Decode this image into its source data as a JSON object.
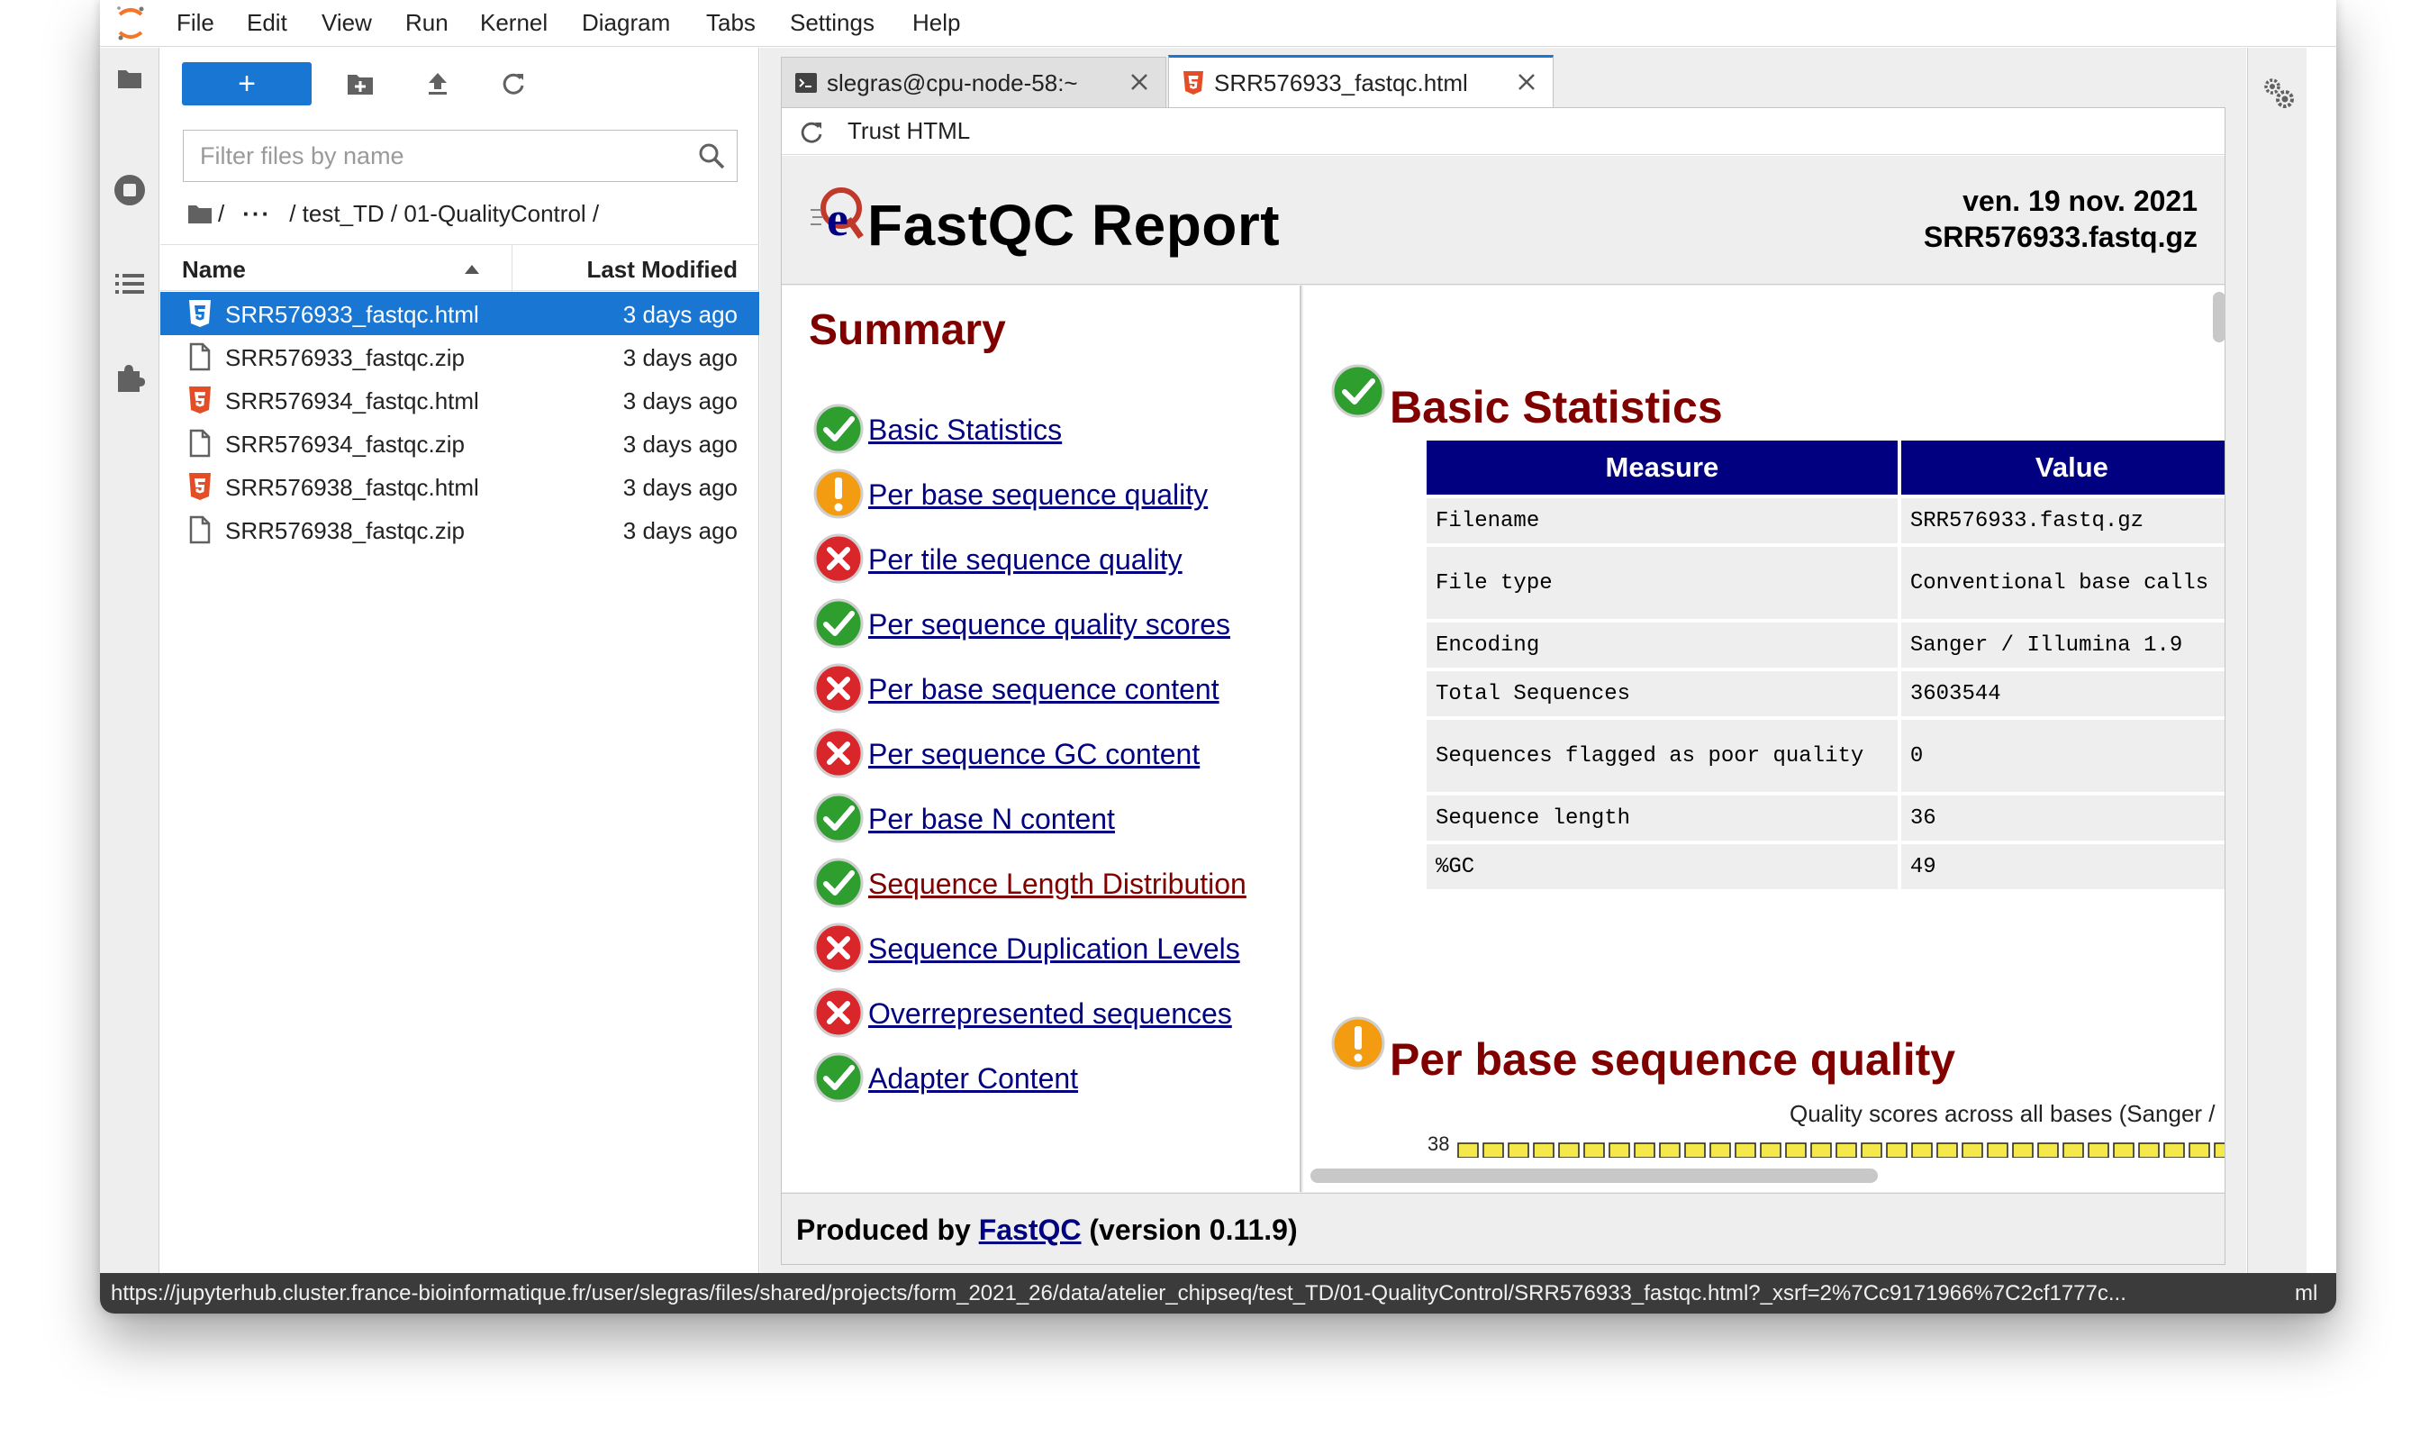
{
  "menu": {
    "items": [
      "File",
      "Edit",
      "View",
      "Run",
      "Kernel",
      "Diagram",
      "Tabs",
      "Settings",
      "Help"
    ]
  },
  "filebrowser": {
    "new_label": "+",
    "filter_placeholder": "Filter files by name",
    "breadcrumb": {
      "root": "/",
      "ellipsis": "···",
      "path": "/ test_TD / 01-QualityControl /"
    },
    "columns": {
      "name": "Name",
      "modified": "Last Modified"
    },
    "files": [
      {
        "name": "SRR576933_fastqc.html",
        "modified": "3 days ago",
        "type": "html",
        "selected": true
      },
      {
        "name": "SRR576933_fastqc.zip",
        "modified": "3 days ago",
        "type": "file",
        "selected": false
      },
      {
        "name": "SRR576934_fastqc.html",
        "modified": "3 days ago",
        "type": "html",
        "selected": false
      },
      {
        "name": "SRR576934_fastqc.zip",
        "modified": "3 days ago",
        "type": "file",
        "selected": false
      },
      {
        "name": "SRR576938_fastqc.html",
        "modified": "3 days ago",
        "type": "html",
        "selected": false
      },
      {
        "name": "SRR576938_fastqc.zip",
        "modified": "3 days ago",
        "type": "file",
        "selected": false
      }
    ]
  },
  "tabs": [
    {
      "label": "slegras@cpu-node-58:~",
      "icon": "terminal-icon",
      "active": false
    },
    {
      "label": "SRR576933_fastqc.html",
      "icon": "html5-icon",
      "active": true
    }
  ],
  "doc_toolbar": {
    "trust_label": "Trust HTML"
  },
  "report": {
    "title": "FastQC Report",
    "date": "ven. 19 nov. 2021",
    "filename": "SRR576933.fastq.gz",
    "summary_title": "Summary",
    "modules": [
      {
        "label": "Basic Statistics",
        "status": "pass",
        "visited": false
      },
      {
        "label": "Per base sequence quality",
        "status": "warn",
        "visited": false
      },
      {
        "label": "Per tile sequence quality",
        "status": "fail",
        "visited": false
      },
      {
        "label": "Per sequence quality scores",
        "status": "pass",
        "visited": false
      },
      {
        "label": "Per base sequence content",
        "status": "fail",
        "visited": false
      },
      {
        "label": "Per sequence GC content",
        "status": "fail",
        "visited": false
      },
      {
        "label": "Per base N content",
        "status": "pass",
        "visited": false
      },
      {
        "label": "Sequence Length Distribution",
        "status": "pass",
        "visited": true
      },
      {
        "label": "Sequence Duplication Levels",
        "status": "fail",
        "visited": false
      },
      {
        "label": "Overrepresented sequences",
        "status": "fail",
        "visited": false
      },
      {
        "label": "Adapter Content",
        "status": "pass",
        "visited": false
      }
    ],
    "basic_stats": {
      "title": "Basic Statistics",
      "headers": [
        "Measure",
        "Value"
      ],
      "rows": [
        [
          "Filename",
          "SRR576933.fastq.gz"
        ],
        [
          "File type",
          "Conventional base calls"
        ],
        [
          "Encoding",
          "Sanger / Illumina 1.9"
        ],
        [
          "Total Sequences",
          "3603544"
        ],
        [
          "Sequences flagged as poor quality",
          "0"
        ],
        [
          "Sequence length",
          "36"
        ],
        [
          "%GC",
          "49"
        ]
      ]
    },
    "per_base_quality": {
      "title": "Per base sequence quality",
      "caption": "Quality scores across all bases (Sanger /",
      "ytick": "38"
    },
    "footer": {
      "prefix": "Produced by ",
      "link": "FastQC",
      "suffix": " (version 0.11.9)"
    }
  },
  "statusbar": {
    "url": "https://jupyterhub.cluster.france-bioinformatique.fr/user/slegras/files/shared/projects/form_2021_26/data/atelier_chipseq/test_TD/01-QualityControl/SRR576933_fastqc.html?_xsrf=2%7Cc9171966%7C2cf1777c...",
    "tail": "ml"
  },
  "colors": {
    "accent": "#1976d2",
    "report_heading": "#800000",
    "link": "#000080",
    "table_header": "#000080",
    "pass": "#2e9e2e",
    "warn": "#f39c12",
    "fail": "#d9262b"
  }
}
